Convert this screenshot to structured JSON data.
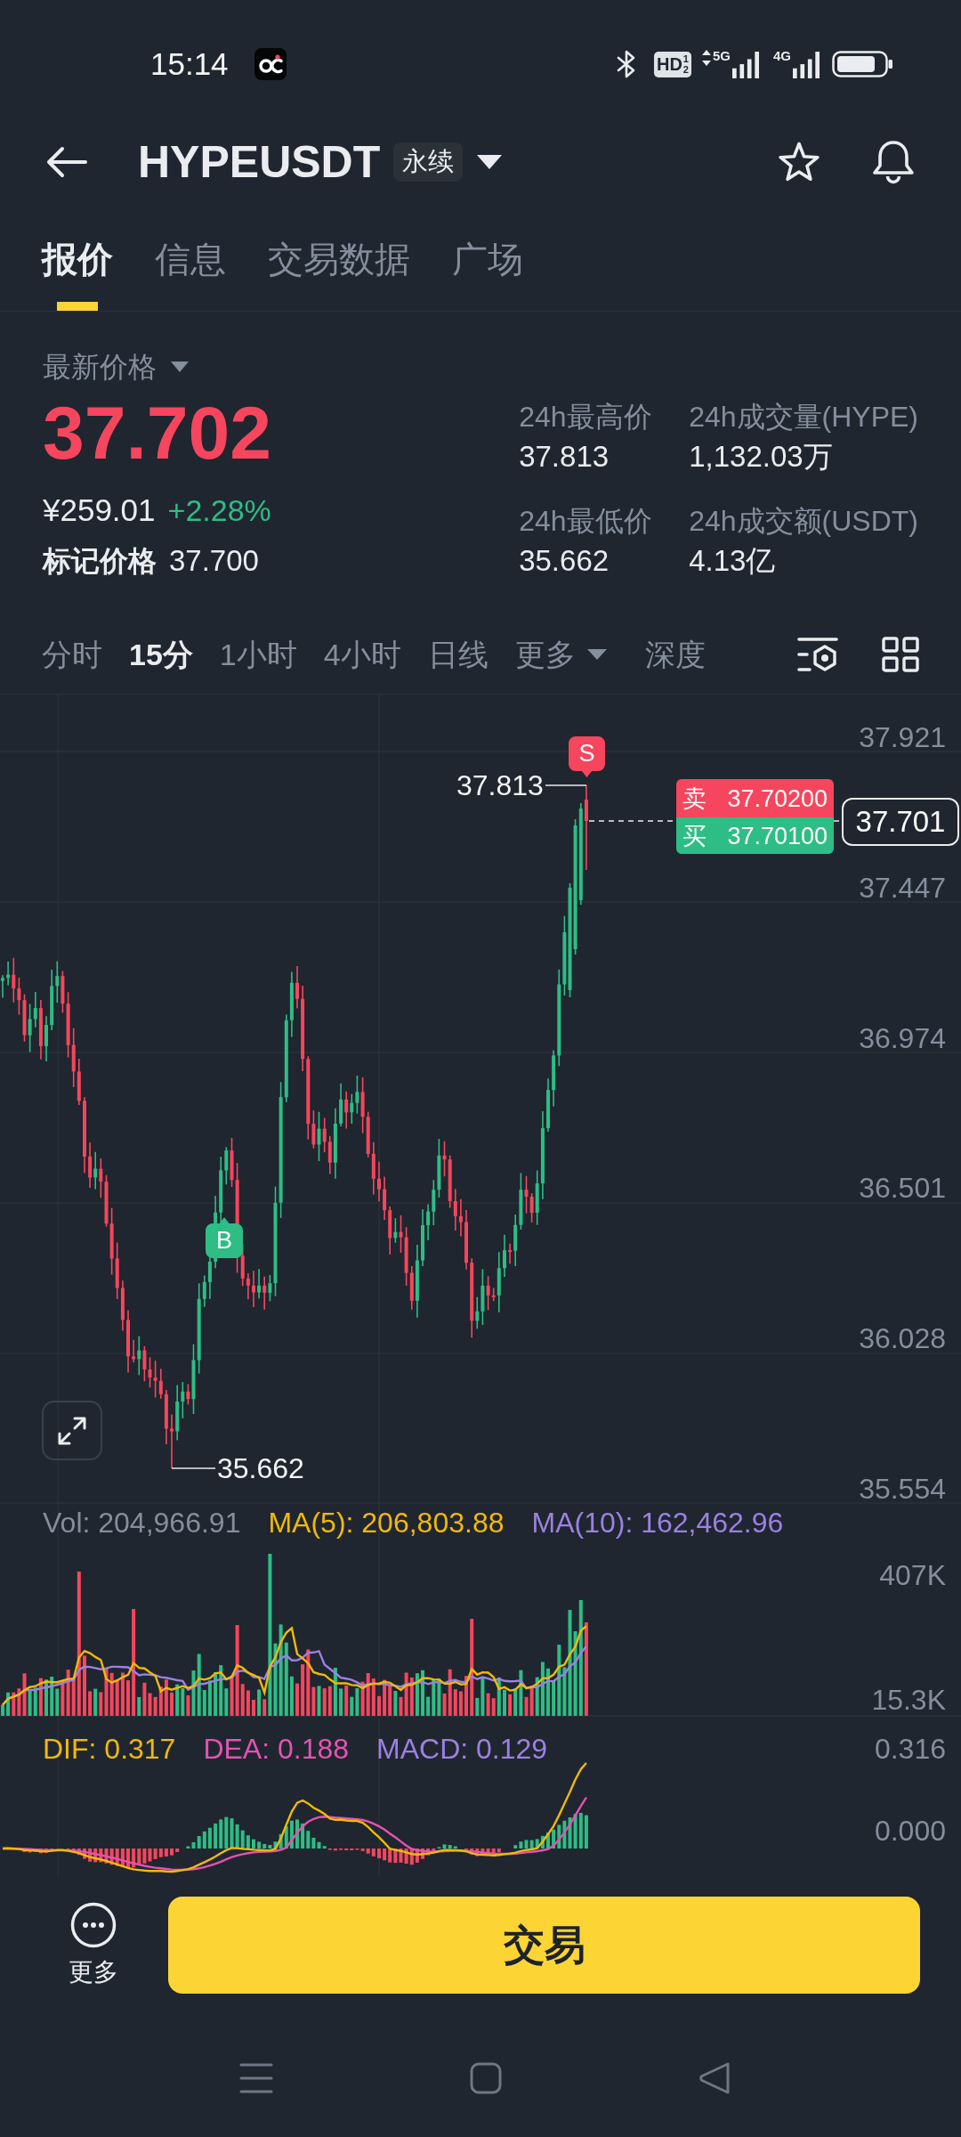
{
  "status_bar": {
    "time": "15:14",
    "hd": {
      "text": "HD",
      "upper": "1",
      "lower": "2"
    },
    "networks": [
      {
        "label": "5G",
        "activity": true
      },
      {
        "label": "4G",
        "activity": false
      }
    ]
  },
  "header": {
    "title": "HYPEUSDT",
    "badge": "永续"
  },
  "tabs": [
    {
      "label": "报价",
      "selected": true
    },
    {
      "label": "信息",
      "selected": false
    },
    {
      "label": "交易数据",
      "selected": false
    },
    {
      "label": "广场",
      "selected": false
    }
  ],
  "price": {
    "label": "最新价格",
    "last": "37.702",
    "last_rising": false,
    "fiat": "¥259.01",
    "change": "+2.28%",
    "change_rising": true,
    "mark_label": "标记价格",
    "mark": "37.700"
  },
  "stats": [
    {
      "label": "24h最高价",
      "value": "37.813"
    },
    {
      "label": "24h成交量(HYPE)",
      "value": "1,132.03万"
    },
    {
      "label": "24h最低价",
      "value": "35.662"
    },
    {
      "label": "24h成交额(USDT)",
      "value": "4.13亿"
    }
  ],
  "intervals": [
    {
      "label": "分时",
      "selected": false,
      "dropdown": false
    },
    {
      "label": "15分",
      "selected": true,
      "dropdown": false
    },
    {
      "label": "1小时",
      "selected": false,
      "dropdown": false
    },
    {
      "label": "4小时",
      "selected": false,
      "dropdown": false
    },
    {
      "label": "日线",
      "selected": false,
      "dropdown": false
    },
    {
      "label": "更多",
      "selected": false,
      "dropdown": true
    },
    {
      "label": "深度",
      "selected": false,
      "dropdown": false
    }
  ],
  "chart": {
    "price_scale": [
      "37.921",
      "37.447",
      "36.974",
      "36.501",
      "36.028",
      "35.554"
    ],
    "high_label": "37.813",
    "low_label": "35.662",
    "signals": [
      {
        "kind": "sell",
        "label": "S"
      },
      {
        "kind": "buy",
        "label": "B"
      }
    ],
    "ask": {
      "side": "卖",
      "price": "37.70200"
    },
    "bid": {
      "side": "买",
      "price": "37.70100"
    },
    "last_price": "37.701"
  },
  "volume": {
    "legend": [
      {
        "text": "Vol: 204,966.91",
        "color": "#848e9c"
      },
      {
        "text": "MA(5): 206,803.88",
        "color": "#f0b90b"
      },
      {
        "text": "MA(10): 162,462.96",
        "color": "#9d80e2"
      }
    ],
    "scale": [
      "407K",
      "15.3K"
    ]
  },
  "macd": {
    "legend": [
      {
        "text": "DIF: 0.317",
        "color": "#f0b90b"
      },
      {
        "text": "DEA: 0.188",
        "color": "#e453b2"
      },
      {
        "text": "MACD: 0.129",
        "color": "#9d80e2"
      }
    ],
    "scale": [
      "0.316",
      "0.000"
    ]
  },
  "bottom_bar": {
    "more": "更多",
    "trade": "交易"
  }
}
